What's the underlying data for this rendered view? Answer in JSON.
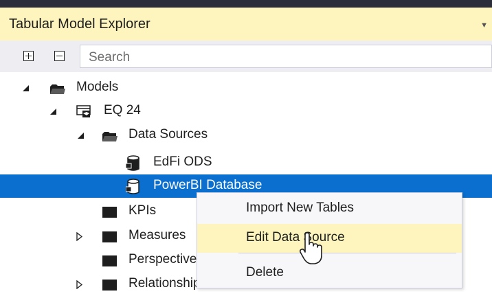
{
  "panel": {
    "title": "Tabular Model Explorer"
  },
  "toolbar": {
    "expand_all_icon": "plus-box-icon",
    "collapse_all_icon": "minus-box-icon",
    "search_placeholder": "Search"
  },
  "tree": {
    "models": "Models",
    "model_name": "EQ 24",
    "data_sources": "Data Sources",
    "source_1": "EdFi ODS",
    "source_2": "PowerBI Database",
    "kpis": "KPIs",
    "measures": "Measures",
    "perspectives": "Perspectives",
    "relationships": "Relationships"
  },
  "context_menu": {
    "items": [
      "Import New Tables",
      "Edit Data Source",
      "Delete"
    ],
    "highlighted": "Edit Data Source"
  },
  "colors": {
    "title_bg": "#fdf4be",
    "selection": "#0a6fcf",
    "menu_hover": "#fdf4be"
  }
}
